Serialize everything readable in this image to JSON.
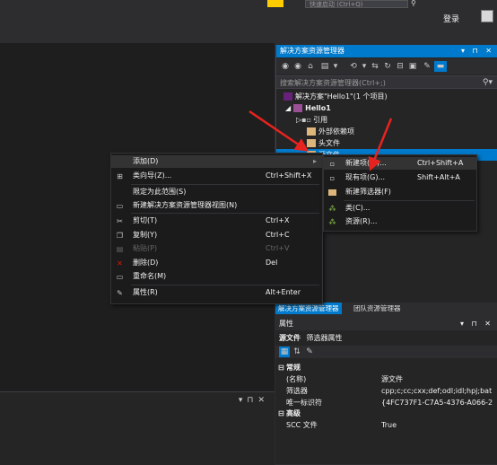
{
  "topbar": {
    "quick_launch_placeholder": "快速启动 (Ctrl+Q)",
    "login": "登录"
  },
  "solution_explorer": {
    "title": "解决方案资源管理器",
    "title_buttons": "▾ ⊓ ✕",
    "search_placeholder": "搜索解决方案资源管理器(Ctrl+;)",
    "tree": [
      {
        "label": "解决方案\"Hello1\"(1 个项目)"
      },
      {
        "label": "Hello1"
      },
      {
        "label": "引用"
      },
      {
        "label": "外部依赖项"
      },
      {
        "label": "头文件"
      },
      {
        "label": "源文件"
      }
    ],
    "tabs": [
      "解决方案资源管理器",
      "团队资源管理器"
    ]
  },
  "context_menu": {
    "items": [
      {
        "label": "添加(D)",
        "shortcut": "",
        "disabled": false
      },
      {
        "label": "类向导(Z)...",
        "shortcut": "Ctrl+Shift+X",
        "disabled": false
      },
      {
        "label": "限定为此范围(S)",
        "shortcut": "",
        "disabled": false
      },
      {
        "label": "新建解决方案资源管理器视图(N)",
        "shortcut": "",
        "disabled": false
      },
      {
        "label": "剪切(T)",
        "shortcut": "Ctrl+X",
        "disabled": false
      },
      {
        "label": "复制(Y)",
        "shortcut": "Ctrl+C",
        "disabled": false
      },
      {
        "label": "粘贴(P)",
        "shortcut": "Ctrl+V",
        "disabled": true
      },
      {
        "label": "删除(D)",
        "shortcut": "Del",
        "disabled": false
      },
      {
        "label": "重命名(M)",
        "shortcut": "",
        "disabled": false
      },
      {
        "label": "属性(R)",
        "shortcut": "Alt+Enter",
        "disabled": false
      }
    ]
  },
  "submenu": {
    "items": [
      {
        "label": "新建项(W)...",
        "shortcut": "Ctrl+Shift+A"
      },
      {
        "label": "现有项(G)...",
        "shortcut": "Shift+Alt+A"
      },
      {
        "label": "新建筛选器(F)",
        "shortcut": ""
      },
      {
        "label": "类(C)...",
        "shortcut": ""
      },
      {
        "label": "资源(R)...",
        "shortcut": ""
      }
    ]
  },
  "properties": {
    "title": "属性",
    "object_name": "源文件",
    "object_type": "筛选器属性",
    "categories": [
      {
        "name": "常规",
        "rows": [
          {
            "key": "(名称)",
            "value": "源文件"
          },
          {
            "key": "筛选器",
            "value": "cpp;c;cc;cxx;def;odl;idl;hpj;bat"
          },
          {
            "key": "唯一标识符",
            "value": "{4FC737F1-C7A5-4376-A066-2"
          }
        ]
      },
      {
        "name": "高级",
        "rows": [
          {
            "key": "SCC 文件",
            "value": "True"
          }
        ]
      }
    ]
  },
  "colors": {
    "accent": "#007acc",
    "annotation_arrow": "#e8231f"
  }
}
